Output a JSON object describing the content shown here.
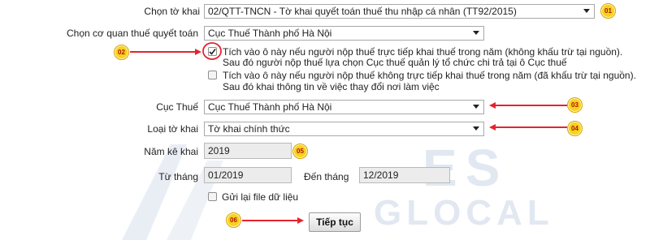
{
  "watermark": {
    "line1": "ES",
    "line2": "GLOCAL"
  },
  "form": {
    "chon_to_khai": {
      "label": "Chọn tờ khai",
      "value": "02/QTT-TNCN - Tờ khai quyết toán thuế thu nhập cá nhân (TT92/2015)"
    },
    "chon_co_quan": {
      "label": "Chọn cơ quan thuế quyết toán",
      "value": "Cục Thuế Thành phố Hà Nội"
    },
    "option1": {
      "checked": true,
      "line1": "Tích vào ô này nếu người nộp thuế trực tiếp khai thuế trong năm (không khấu trừ tại nguồn).",
      "line2": "Sau đó người nộp thuế lựa chọn Cục thuế quản lý tổ chức chi trả tại ô Cục thuế"
    },
    "option2": {
      "checked": false,
      "line1": "Tích vào ô này nếu người nộp thuế không trực tiếp khai thuế trong năm (đã khấu trừ tại nguồn).",
      "line2": "Sau đó khai thông tin về việc thay đổi nơi làm việc"
    },
    "cuc_thue": {
      "label": "Cục Thuế",
      "value": "Cục Thuế Thành phố Hà Nội"
    },
    "loai_to_khai": {
      "label": "Loại tờ khai",
      "value": "Tờ khai chính thức"
    },
    "nam_ke_khai": {
      "label": "Năm kê khai",
      "value": "2019"
    },
    "tu_thang": {
      "label": "Từ tháng",
      "value": "01/2019"
    },
    "den_thang": {
      "label": "Đến tháng",
      "value": "12/2019"
    },
    "gui_lai": {
      "label": "Gửi lại file dữ liệu",
      "checked": false
    },
    "tiep_tuc": {
      "label": "Tiếp tục"
    }
  },
  "annotations": {
    "b01": "01",
    "b02": "02",
    "b03": "03",
    "b04": "04",
    "b05": "05",
    "b06": "06",
    "badge_color": "#f7d21a",
    "arrow_color": "#e52330"
  }
}
